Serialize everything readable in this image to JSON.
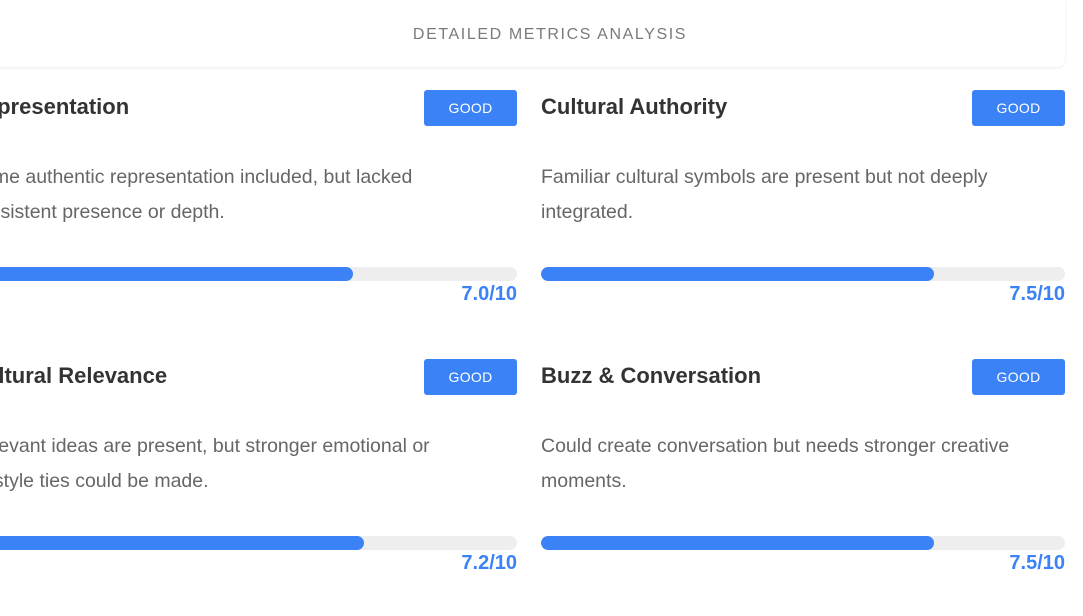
{
  "header": {
    "title": "DETAILED METRICS ANALYSIS"
  },
  "metrics": [
    {
      "title": "Representation",
      "badge": "GOOD",
      "description": "Some authentic representation included, but lacked consistent presence or depth.",
      "score": 7.0,
      "score_label": "7.0/10"
    },
    {
      "title": "Cultural Authority",
      "badge": "GOOD",
      "description": "Familiar cultural symbols are present but not deeply integrated.",
      "score": 7.5,
      "score_label": "7.5/10"
    },
    {
      "title": "Cultural Relevance",
      "badge": "GOOD",
      "description": "Relevant ideas are present, but stronger emotional or lifestyle ties could be made.",
      "score": 7.2,
      "score_label": "7.2/10"
    },
    {
      "title": "Buzz & Conversation",
      "badge": "GOOD",
      "description": "Could create conversation but needs stronger creative moments.",
      "score": 7.5,
      "score_label": "7.5/10"
    }
  ],
  "colors": {
    "accent": "#3b82f6",
    "track": "#eeeeee",
    "title": "#333333",
    "description": "#666666"
  }
}
